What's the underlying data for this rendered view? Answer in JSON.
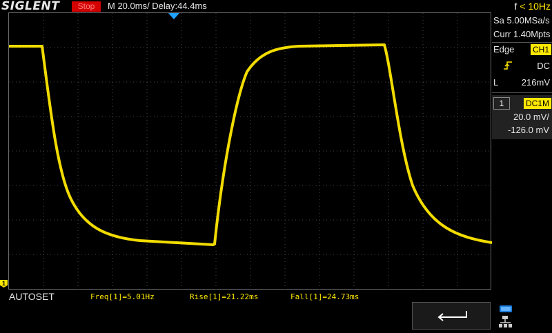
{
  "header": {
    "brand": "SIGLENT",
    "status": "Stop",
    "timebase": "M 20.0ms/ Delay:44.4ms",
    "freq_prefix": "f",
    "freq_value": "< 10Hz"
  },
  "panel": {
    "sample_rate": "Sa 5.00MSa/s",
    "memory": "Curr 1.40Mpts",
    "trigger_type": "Edge",
    "trigger_source": "CH1",
    "coupling": "DC",
    "level_label": "L",
    "level_value": "216mV",
    "channel_number": "1",
    "channel_coupling": "DC1M",
    "volts_div": "20.0 mV/",
    "offset": "-126.0 mV"
  },
  "bottom": {
    "autoset": "AUTOSET",
    "measurements": [
      {
        "label": "Freq[1]=5.01Hz"
      },
      {
        "label": "Rise[1]=21.22ms"
      },
      {
        "label": "Fall[1]=24.73ms"
      }
    ]
  },
  "colors": {
    "trace": "#ffe800",
    "stop_bg": "#d40000",
    "trigger_marker": "#1fa3ff"
  },
  "icons": {
    "back": "back-arrow-icon",
    "network": "network-icon",
    "trigger_edge": "rising-edge-icon"
  }
}
